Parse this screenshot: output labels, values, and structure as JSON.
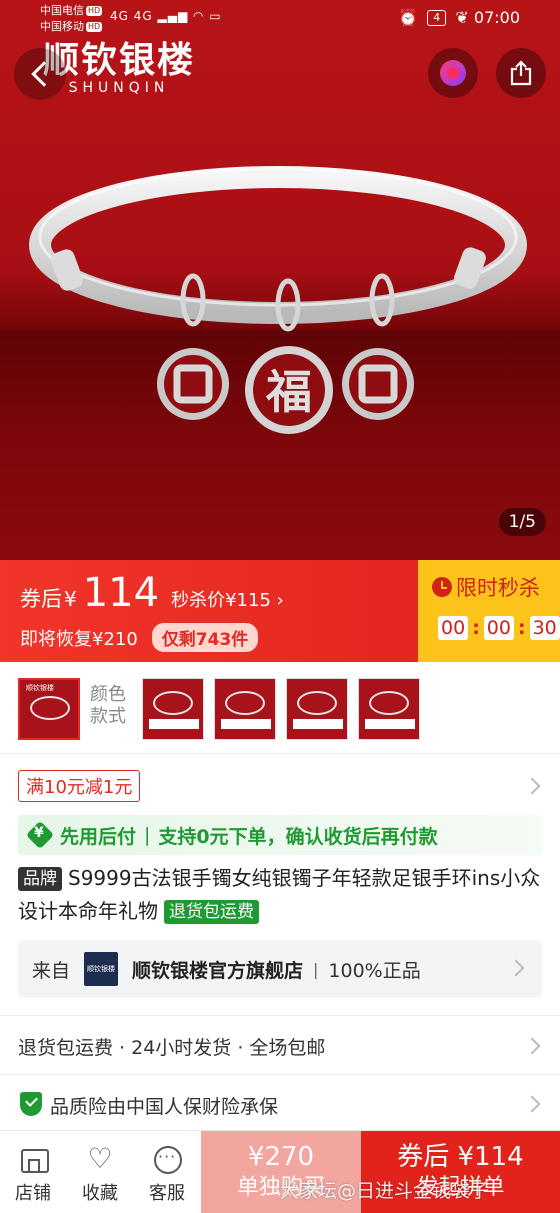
{
  "status_bar": {
    "carrier1": "中国电信",
    "carrier2": "中国移动",
    "hd": "HD",
    "network": "4G 4G",
    "battery": "4",
    "time": "07:00"
  },
  "hero": {
    "brand_cn": "顺钦银楼",
    "brand_en": "SHUNQIN",
    "pager": "1/5"
  },
  "price": {
    "after_coupon_label": "券后",
    "currency": "¥",
    "after_coupon_value": "114",
    "seckill_label": "秒杀价¥115",
    "seckill_arrow": "›",
    "restore_text": "即将恢复¥210",
    "remaining": "仅剩743件",
    "flash_title": "限时秒杀",
    "countdown": [
      "00",
      "00",
      "30"
    ],
    "colors": {
      "accent": "#e22a22",
      "flash_bg": "#fcc41b"
    }
  },
  "options": {
    "label": "颜色款式",
    "first_thumb_tag": "顺钦银楼",
    "thumb_count": 5
  },
  "coupon": {
    "text": "满10元减1元"
  },
  "pay_later": {
    "title": "先用后付",
    "separator": "|",
    "desc": "支持0元下单，确认收货后再付款"
  },
  "product": {
    "brand_tag": "品牌",
    "title": "S9999古法银手镯女纯银镯子年轻款足银手环ins小众设计本命年礼物",
    "return_tag": "退货包运费"
  },
  "shop": {
    "from": "来自",
    "logo_text": "顺钦银楼",
    "name": "顺钦银楼官方旗舰店",
    "separator": "|",
    "genuine": "100%正品"
  },
  "service": {
    "text": "退货包运费 · 24小时发货 · 全场包邮"
  },
  "insurance": {
    "text": "品质险由中国人保财险承保"
  },
  "bottom": {
    "store": "店铺",
    "favorite": "收藏",
    "service": "客服",
    "solo_price": "¥270",
    "solo_label": "单独购买",
    "group_price": "券后 ¥114",
    "group_label": "发起拼单"
  },
  "watermark": "大家坛@日进斗金钱袋子"
}
